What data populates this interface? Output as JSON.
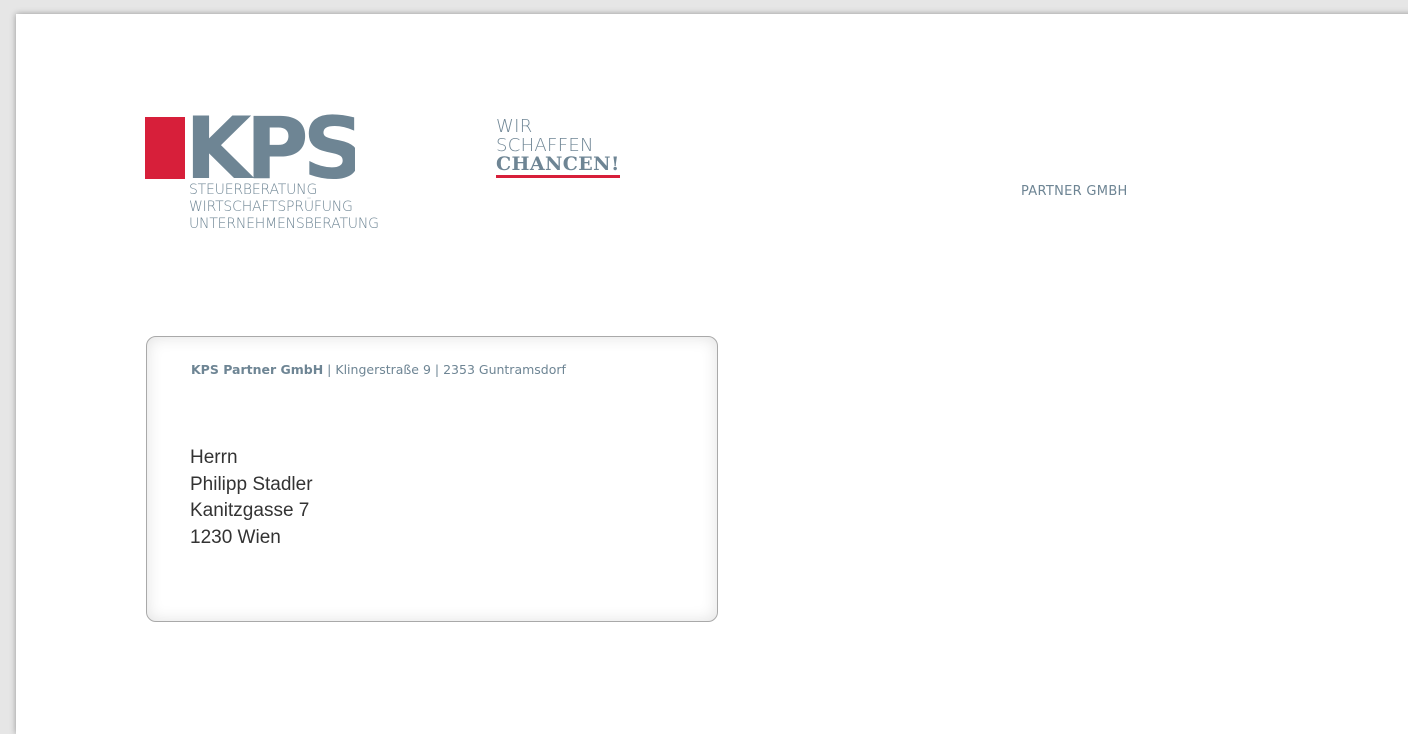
{
  "logo": {
    "text": "KPS",
    "lines": [
      "STEUERBERATUNG",
      "WIRTSCHAFTSPRÜFUNG",
      "UNTERNEHMENSBERATUNG"
    ],
    "colors": {
      "red": "#d71f3a",
      "gray": "#6e8594"
    }
  },
  "slogan": {
    "line1": "WIR",
    "line2": "SCHAFFEN",
    "line3": "CHANCEN!"
  },
  "partner_label": "PARTNER GMBH",
  "sender": {
    "company": "KPS Partner GmbH",
    "separator1": " | ",
    "street": "Klingerstraße 9",
    "separator2": " | ",
    "city": "2353 Guntramsdorf"
  },
  "recipient": {
    "salutation": "Herrn",
    "name": "Philipp Stadler",
    "street": "Kanitzgasse 7",
    "city": "1230 Wien"
  }
}
